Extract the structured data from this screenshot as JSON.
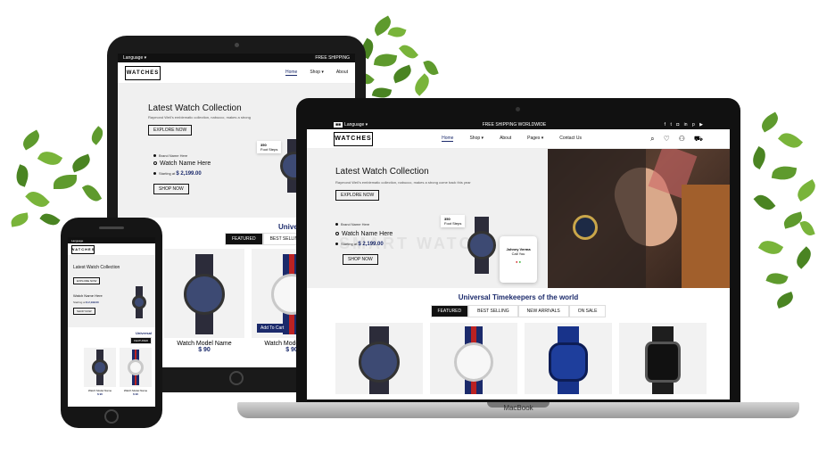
{
  "brand": {
    "logo_text": "WATCHES",
    "logo_sub": "UNIVERSAL TIMEKEEPERS"
  },
  "topbar": {
    "language": "Language",
    "shipping": "FREE SHIPPING WORLDWIDE",
    "shipping_short": "FREE SHIPPING"
  },
  "nav": {
    "home": "Home",
    "shop": "Shop",
    "about": "About",
    "pages": "Pages",
    "contact": "Contact Us"
  },
  "hero": {
    "title": "Latest Watch Collection",
    "subtitle": "Raymond Weil's emblematic collection, nabucco, makes a strong come back this year",
    "subtitle_short": "Raymond Weil's emblematic collection, nabucco, makes a strong",
    "explore": "EXPLORE NOW",
    "brand_label": "Brand Name Here",
    "watch_name": "Watch Name Here",
    "starting_at": "Starting at",
    "price": "$ 2,199.00",
    "price_phone": "$ 2,199.00",
    "shop_now": "SHOP NOW",
    "steps_count": "350",
    "steps_label": "Foot Steps",
    "caller": "Johney Verma",
    "call_sub": "Call You",
    "watermark": "SMART WATCH"
  },
  "section": {
    "title": "Universal Timekeepers of the world",
    "title_short": "Universal",
    "tabs": [
      "FEATURED",
      "BEST SELLING",
      "NEW ARRIVALS",
      "ON SALE"
    ]
  },
  "products": {
    "name": "Watch Model Name",
    "price": "$ 90",
    "add_to_cart": "Add To Cart"
  },
  "laptop_brand": "MacBook",
  "colors": {
    "accent": "#1b2a6b",
    "dark": "#111111",
    "leaf": "#5e9a2d"
  }
}
